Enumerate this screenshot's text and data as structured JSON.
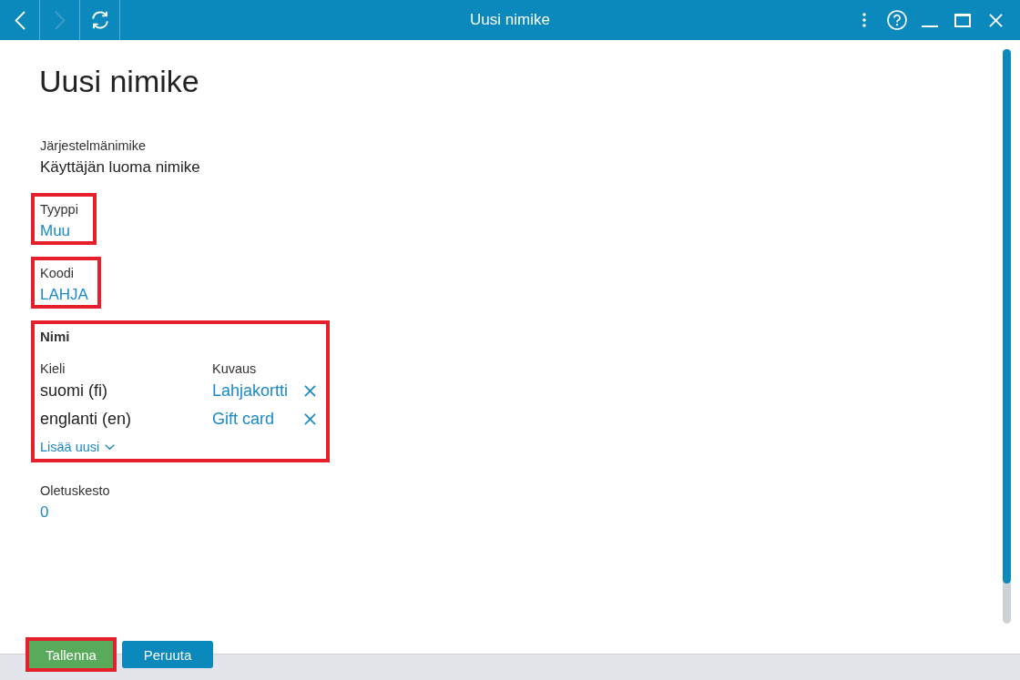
{
  "window": {
    "title": "Uusi nimike",
    "nav": [
      {
        "kind": "back",
        "disabled": false
      },
      {
        "kind": "forward",
        "disabled": true
      },
      {
        "kind": "refresh",
        "disabled": false
      }
    ],
    "controls": [
      {
        "kind": "more"
      },
      {
        "kind": "help"
      },
      {
        "kind": "minimize"
      },
      {
        "kind": "maximize"
      },
      {
        "kind": "close"
      }
    ]
  },
  "heading": "Uusi nimike",
  "fields": [
    {
      "kind": "text",
      "label": "Järjestelmänimike",
      "value": "Käyttäjän luoma nimike",
      "highlighted": false
    },
    {
      "kind": "link",
      "label": "Tyyppi",
      "value": "Muu",
      "highlighted": true
    },
    {
      "kind": "link",
      "label": "Koodi",
      "value": "LAHJA",
      "highlighted": true
    },
    {
      "kind": "table",
      "label": "Nimi",
      "highlighted": true,
      "columns": [
        "Kieli",
        "Kuvaus"
      ],
      "rows": [
        {
          "language": "suomi (fi)",
          "description": "Lahjakortti"
        },
        {
          "language": "englanti (en)",
          "description": "Gift card"
        }
      ],
      "add_label": "Lisää uusi"
    },
    {
      "kind": "link",
      "label": "Oletuskesto",
      "value": "0",
      "highlighted": false
    }
  ],
  "buttons": [
    {
      "kind": "primary",
      "label": "Tallenna",
      "highlighted": true
    },
    {
      "kind": "secondary",
      "label": "Peruuta",
      "highlighted": false
    }
  ]
}
